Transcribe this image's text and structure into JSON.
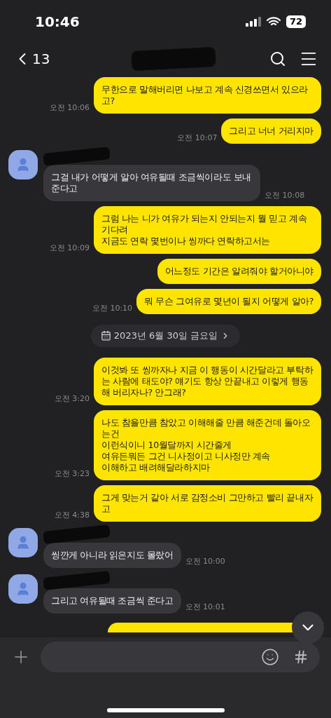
{
  "status_bar": {
    "time": "10:46",
    "battery": "72"
  },
  "header": {
    "back_count": "13"
  },
  "messages": [
    {
      "kind": "sent",
      "text": "무한으로 말해버리면 나보고 계속 신경쓰면서 있으라고?",
      "time": "오전 10:06"
    },
    {
      "kind": "sent",
      "text": "그리고 너너 거리지마",
      "time": "오전 10:07"
    },
    {
      "kind": "received",
      "text": "그걸 내가 어떻게 알아 여유될때 조금씩이라도 보내준다고",
      "time": "오전 10:08"
    },
    {
      "kind": "sent",
      "text": "그럼 나는 니가 여유가 되는지 안되는지 뭘 믿고 계속 기다려\n지금도 연락 몇번이나 씽까다 연락하고서는",
      "time": "오전 10:09"
    },
    {
      "kind": "sent",
      "text": "어느정도 기간은 알려줘야 할거아니야"
    },
    {
      "kind": "sent",
      "text": "뭐 무슨 그여유로 몇년이 될지 어떻게 알아?",
      "time": "오전 10:10"
    },
    {
      "kind": "date",
      "text": "2023년 6월 30일 금요일"
    },
    {
      "kind": "sent",
      "text": "이것봐 또 씽까자나 지금 이 행동이 시간달라고 부탁하는 사람에 태도야? 얘기도 항상 안끝내고 이렇게 행동해 버리자나? 안그래?",
      "time": "오전 3:20"
    },
    {
      "kind": "sent",
      "text": "나도 참을만큼 참았고 이해해줄 만큼 해준건데 돌아오는건\n이런식이니 10월달까지 시간줄게\n여유든뭐든 그건 니사정이고 니사정만 계속\n이해하고 배려해달라하지마",
      "time": "오전 3:23"
    },
    {
      "kind": "sent",
      "text": "그게 맞는거 같아 서로 감정소비 그만하고 빨리 끝내자고",
      "time": "오전 4:38"
    },
    {
      "kind": "received",
      "text": "씽깐게 아니라 읽은지도 몰랐어",
      "time": "오전 10:00"
    },
    {
      "kind": "received",
      "text": "그리고 여유될때 조금씩 준다고",
      "time": "오전 10:01"
    }
  ]
}
